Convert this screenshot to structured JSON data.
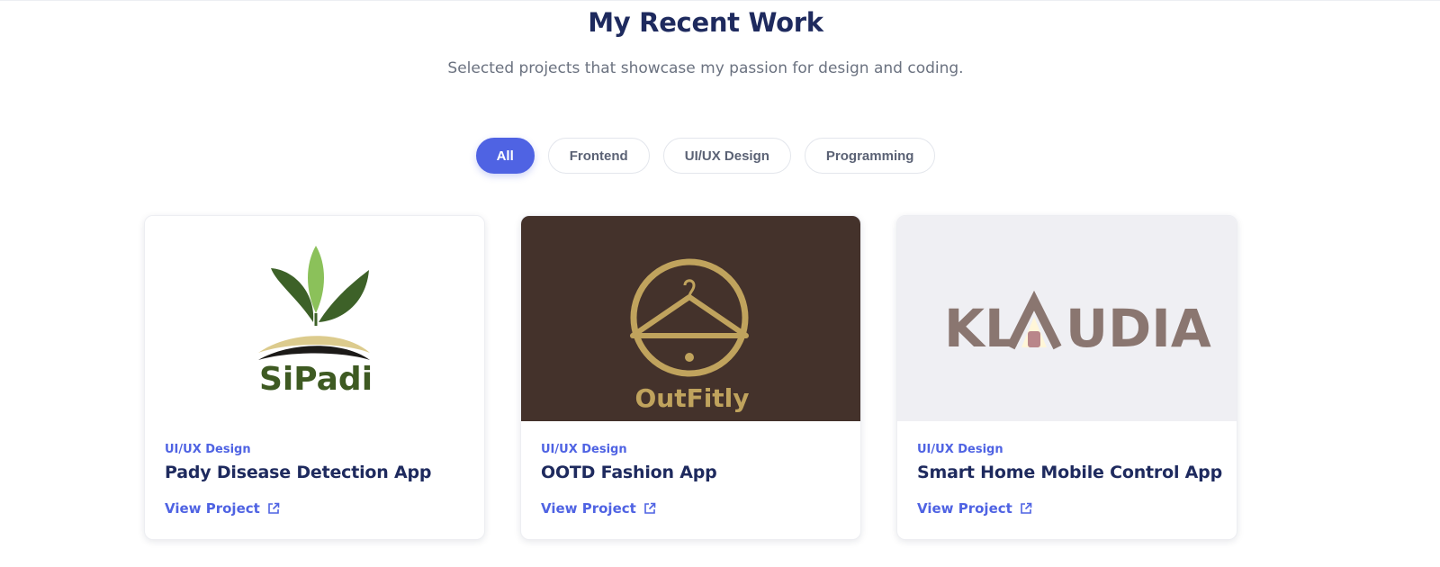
{
  "section": {
    "title": "My Recent Work",
    "subtitle": "Selected projects that showcase my passion for design and coding."
  },
  "filters": [
    {
      "label": "All",
      "active": true
    },
    {
      "label": "Frontend",
      "active": false
    },
    {
      "label": "UI/UX Design",
      "active": false
    },
    {
      "label": "Programming",
      "active": false
    }
  ],
  "projects": [
    {
      "category": "UI/UX Design",
      "title": "Pady Disease Detection App",
      "link_label": "View Project",
      "logo_text": "SiPadi",
      "thumb_bg": "#ffffff"
    },
    {
      "category": "UI/UX Design",
      "title": "OOTD Fashion App",
      "link_label": "View Project",
      "logo_text": "OutFitly",
      "thumb_bg": "#44322b"
    },
    {
      "category": "UI/UX Design",
      "title": "Smart Home Mobile Control App",
      "link_label": "View Project",
      "logo_text_left": "KL",
      "logo_text_right": "UDIA",
      "thumb_bg": "#efeff3"
    }
  ],
  "colors": {
    "accent": "#4f63e3",
    "heading": "#1e2a5e",
    "muted": "#6b7280"
  },
  "icons": {
    "link": "external-link-icon"
  }
}
